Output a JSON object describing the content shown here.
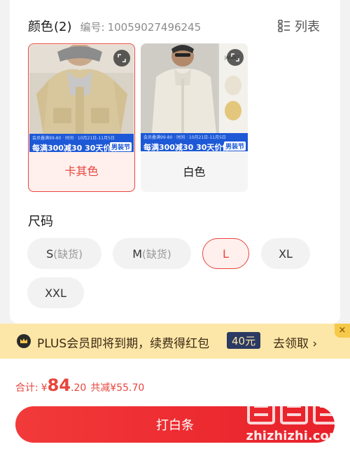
{
  "color_section": {
    "title": "颜色",
    "count": "(2)",
    "sku_label": "编号:",
    "sku_value": "10059027496245",
    "list_label": "列表"
  },
  "swatches": [
    {
      "name": "卡其色",
      "promo": "每满300减30 30天价保",
      "promo_sub": "会员叠满99-80 · 时间 · 10月21日-11月5日",
      "fest": "男装节",
      "selected": true
    },
    {
      "name": "白色",
      "promo": "每满300减30 30天价保",
      "promo_sub": "会员叠满99-80 · 时间 · 10月21日-11月5日",
      "fest": "男装节",
      "selected": false
    }
  ],
  "size_section": {
    "title": "尺码",
    "sizes": [
      {
        "label": "S",
        "note": "(缺货)",
        "selected": false
      },
      {
        "label": "M",
        "note": "(缺货)",
        "selected": false
      },
      {
        "label": "L",
        "note": "",
        "selected": true
      },
      {
        "label": "XL",
        "note": "",
        "selected": false
      },
      {
        "label": "XXL",
        "note": "",
        "selected": false
      }
    ]
  },
  "plus_bar": {
    "text": "PLUS会员即将到期，续费得红包",
    "coupon": "40元",
    "claim": "去领取",
    "chevron": "›",
    "close": "×"
  },
  "footer": {
    "total_label": "合计:",
    "currency": "¥",
    "price_int": "84",
    "price_dec": ".20",
    "saved": "共减¥55.70",
    "pay_button": "打白条"
  },
  "watermark": {
    "text": "zhizhizhi.com"
  },
  "colors": {
    "accent": "#e8453c",
    "plus_bg": "#fde7a8",
    "coupon_bg": "#2b3a63",
    "banner_blue": "#1d58d6"
  }
}
